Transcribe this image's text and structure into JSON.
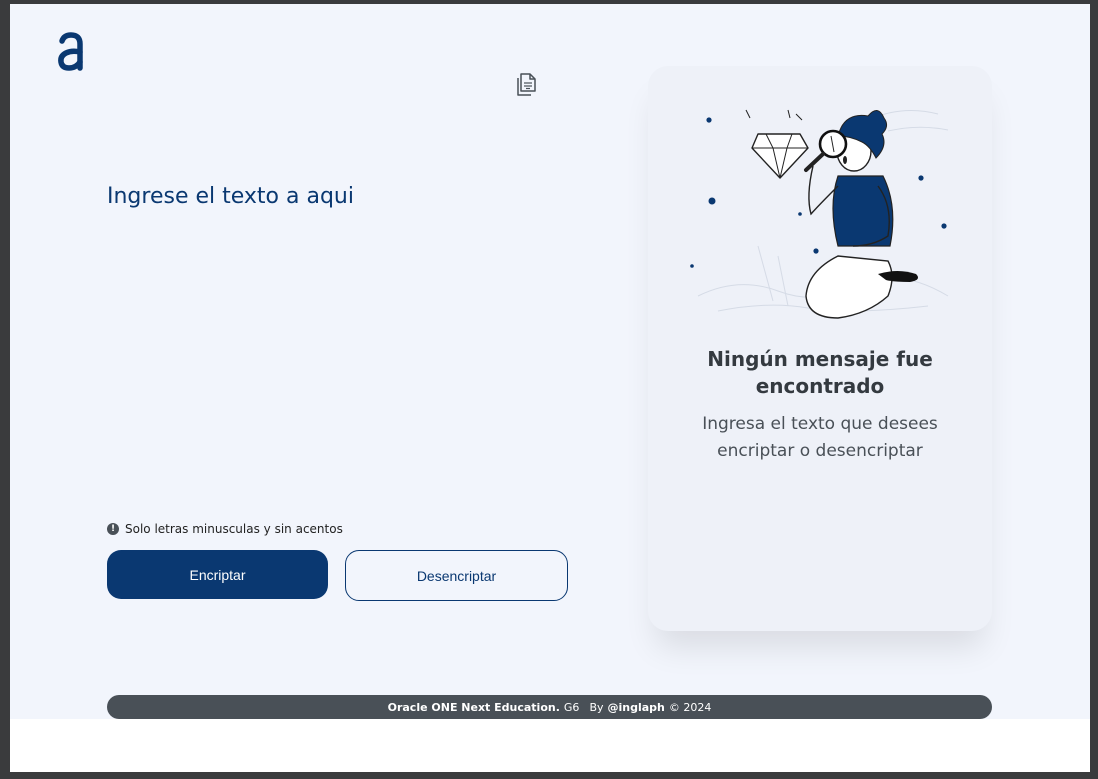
{
  "header": {
    "logo_icon": "alura-logo-icon",
    "copy_icon": "copy-icon"
  },
  "input": {
    "placeholder": "Ingrese el texto a aqui",
    "value": ""
  },
  "hint": {
    "icon": "exclamation-circle-icon",
    "text": "Solo letras minusculas y sin acentos"
  },
  "buttons": {
    "encrypt_label": "Encriptar",
    "decrypt_label": "Desencriptar"
  },
  "output_card": {
    "illustration": "man-with-magnifying-glass-illustration",
    "title": "Ningún mensaje fue encontrado",
    "subtitle": "Ingresa el texto que desees encriptar o desencriptar"
  },
  "footer": {
    "org": "Oracle ONE Next Education.",
    "group": "G6",
    "by_label": "By",
    "author": "@inglaph",
    "copyright": "© 2024"
  },
  "colors": {
    "primary": "#0a3871",
    "background": "#f2f5fc",
    "footer_bg": "#495057",
    "title_text": "#343a40"
  }
}
